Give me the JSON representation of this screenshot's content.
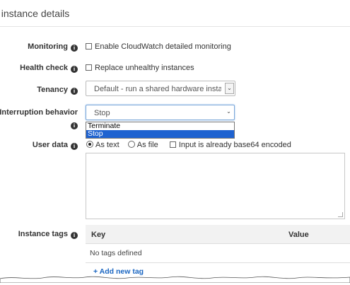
{
  "section": {
    "title": "Configure instance details",
    "visible_title": "t instance details"
  },
  "monitoring": {
    "label": "Monitoring",
    "checkbox_label": "Enable CloudWatch detailed monitoring",
    "checked": false
  },
  "health_check": {
    "label": "Health check",
    "checkbox_label": "Replace unhealthy instances",
    "checked": false
  },
  "tenancy": {
    "label": "Tenancy",
    "value": "Default - run a shared hardware instance"
  },
  "interruption": {
    "label": "Interruption behavior",
    "value": "Stop",
    "options": [
      "Terminate",
      "Stop"
    ],
    "selected_index": 1
  },
  "user_data": {
    "label": "User data",
    "as_text": "As text",
    "as_file": "As file",
    "base64": "Input is already base64 encoded",
    "mode": "as_text",
    "content": ""
  },
  "instance_tags": {
    "label": "Instance tags",
    "columns": [
      "Key",
      "Value"
    ],
    "empty_text": "No tags defined",
    "add_link": "+ Add new tag"
  },
  "icons": {
    "info": "info-icon",
    "dropdown": "chevron-down-icon"
  },
  "colors": {
    "link": "#1a66c2",
    "selection": "#1e62d0",
    "focus": "#7aa7d9"
  }
}
